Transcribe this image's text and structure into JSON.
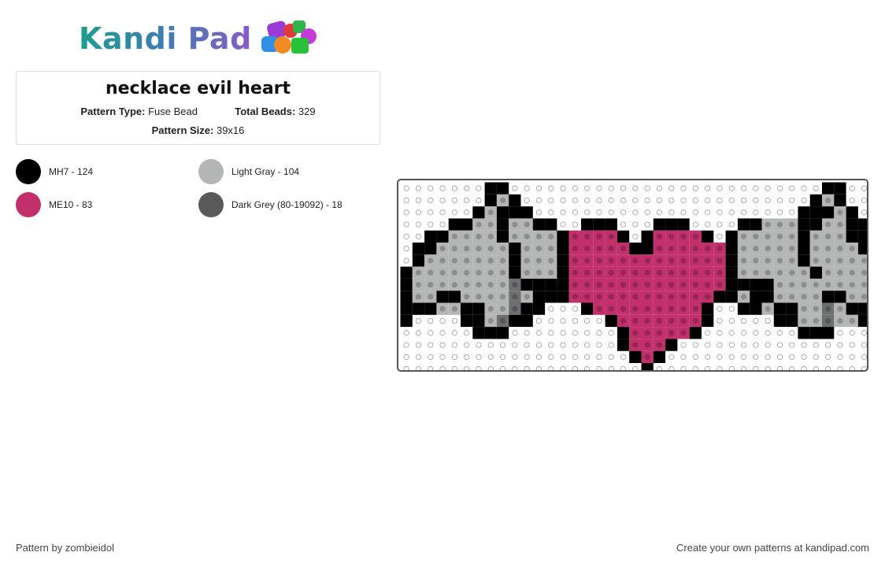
{
  "header": {
    "logo_text": "Kandi Pad"
  },
  "pattern": {
    "title": "necklace evil heart",
    "type_label": "Pattern Type:",
    "type_value": "Fuse Bead",
    "beads_label": "Total Beads:",
    "beads_value": "329",
    "size_label": "Pattern Size:",
    "size_value": "39x16"
  },
  "legend": [
    {
      "label": "MH7 - 124",
      "color": "#000000"
    },
    {
      "label": "Light Gray - 104",
      "color": "#b3b6b4"
    },
    {
      "label": "ME10 - 83",
      "color": "#c2306b"
    },
    {
      "label": "Dark Grey (80-19092) - 18",
      "color": "#58595b"
    }
  ],
  "footer": {
    "author": "Pattern by zombieidol",
    "cta": "Create your own patterns at kandipad.com"
  },
  "board": {
    "cols": 39,
    "rows": 16,
    "palette": {
      "K": "#000000",
      "L": "#b3b6b4",
      "P": "#c2306b",
      "D": "#6e6f71"
    },
    "grid": [
      ".......KK..........................KK..",
      ".......KLK........................KLK..",
      "......KLKKK......................KKKLK..",
      "....KKLLKLLKK..KKK...KKK....KKLLLKKLLKK.",
      "..KKLLLLKLLLLKPPPPK.KPPPPK.KLLLLLKLLLKK..",
      ".KKLLLLLLKLLLKPPPPPKKPPPPPPKLLLLLKLLLLKK.",
      ".KLLLLLLLKLLLKPPPPPPPPPPPPPKLLLLLKLLLLLK",
      "KLLLLLLLLKLLLKPPPPPPPPPPPPPKLLLLLLKLLLLLK",
      "KLLLLLLLLDKKKKPPPPPPPPPPPPPKKKKLLLLLLLLLK",
      "KLLKKLLLLDLKKKPPPPPPPPPPPPKKLKKLLLLKKLLLK",
      "KKKLLKKLLDKK...KPPPPPPPPPK..KKLKKLLDLKKLK",
      "K....KKLDKK......KPPPPPPPK.....KKLLDLLKKK",
      "......KKK.........KPPPPPK........KKK.....",
      "..................KPPPK....................",
      "...................KPK.....................",
      "....................K.................."
    ]
  }
}
